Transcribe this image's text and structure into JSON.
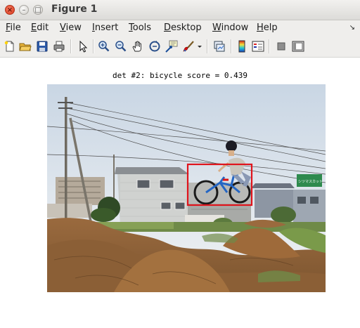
{
  "window": {
    "title": "Figure 1",
    "close_glyph": "×",
    "min_glyph": "–",
    "max_glyph": "□"
  },
  "menu": {
    "items": [
      {
        "mnemonic": "F",
        "rest": "ile"
      },
      {
        "mnemonic": "E",
        "rest": "dit"
      },
      {
        "mnemonic": "V",
        "rest": "iew"
      },
      {
        "mnemonic": "I",
        "rest": "nsert"
      },
      {
        "mnemonic": "T",
        "rest": "ools"
      },
      {
        "mnemonic": "D",
        "rest": "esktop"
      },
      {
        "mnemonic": "W",
        "rest": "indow"
      },
      {
        "mnemonic": "H",
        "rest": "elp"
      }
    ],
    "dock_glyph": "↘"
  },
  "toolbar": {
    "icons": [
      "new-figure-icon",
      "open-file-icon",
      "save-icon",
      "print-icon",
      "select-arrow-icon",
      "zoom-in-icon",
      "zoom-out-icon",
      "pan-hand-icon",
      "rotate-3d-icon",
      "data-cursor-icon",
      "brush-icon",
      "brush-dropdown-icon",
      "link-plot-icon",
      "colorbar-icon",
      "legend-icon",
      "hide-plot-tools-icon",
      "show-plot-tools-icon"
    ]
  },
  "figure": {
    "axes_title": "det #2: bicycle score = 0.439",
    "detection_box_color": "#e0141c",
    "sign_text": "シツマスカット"
  }
}
